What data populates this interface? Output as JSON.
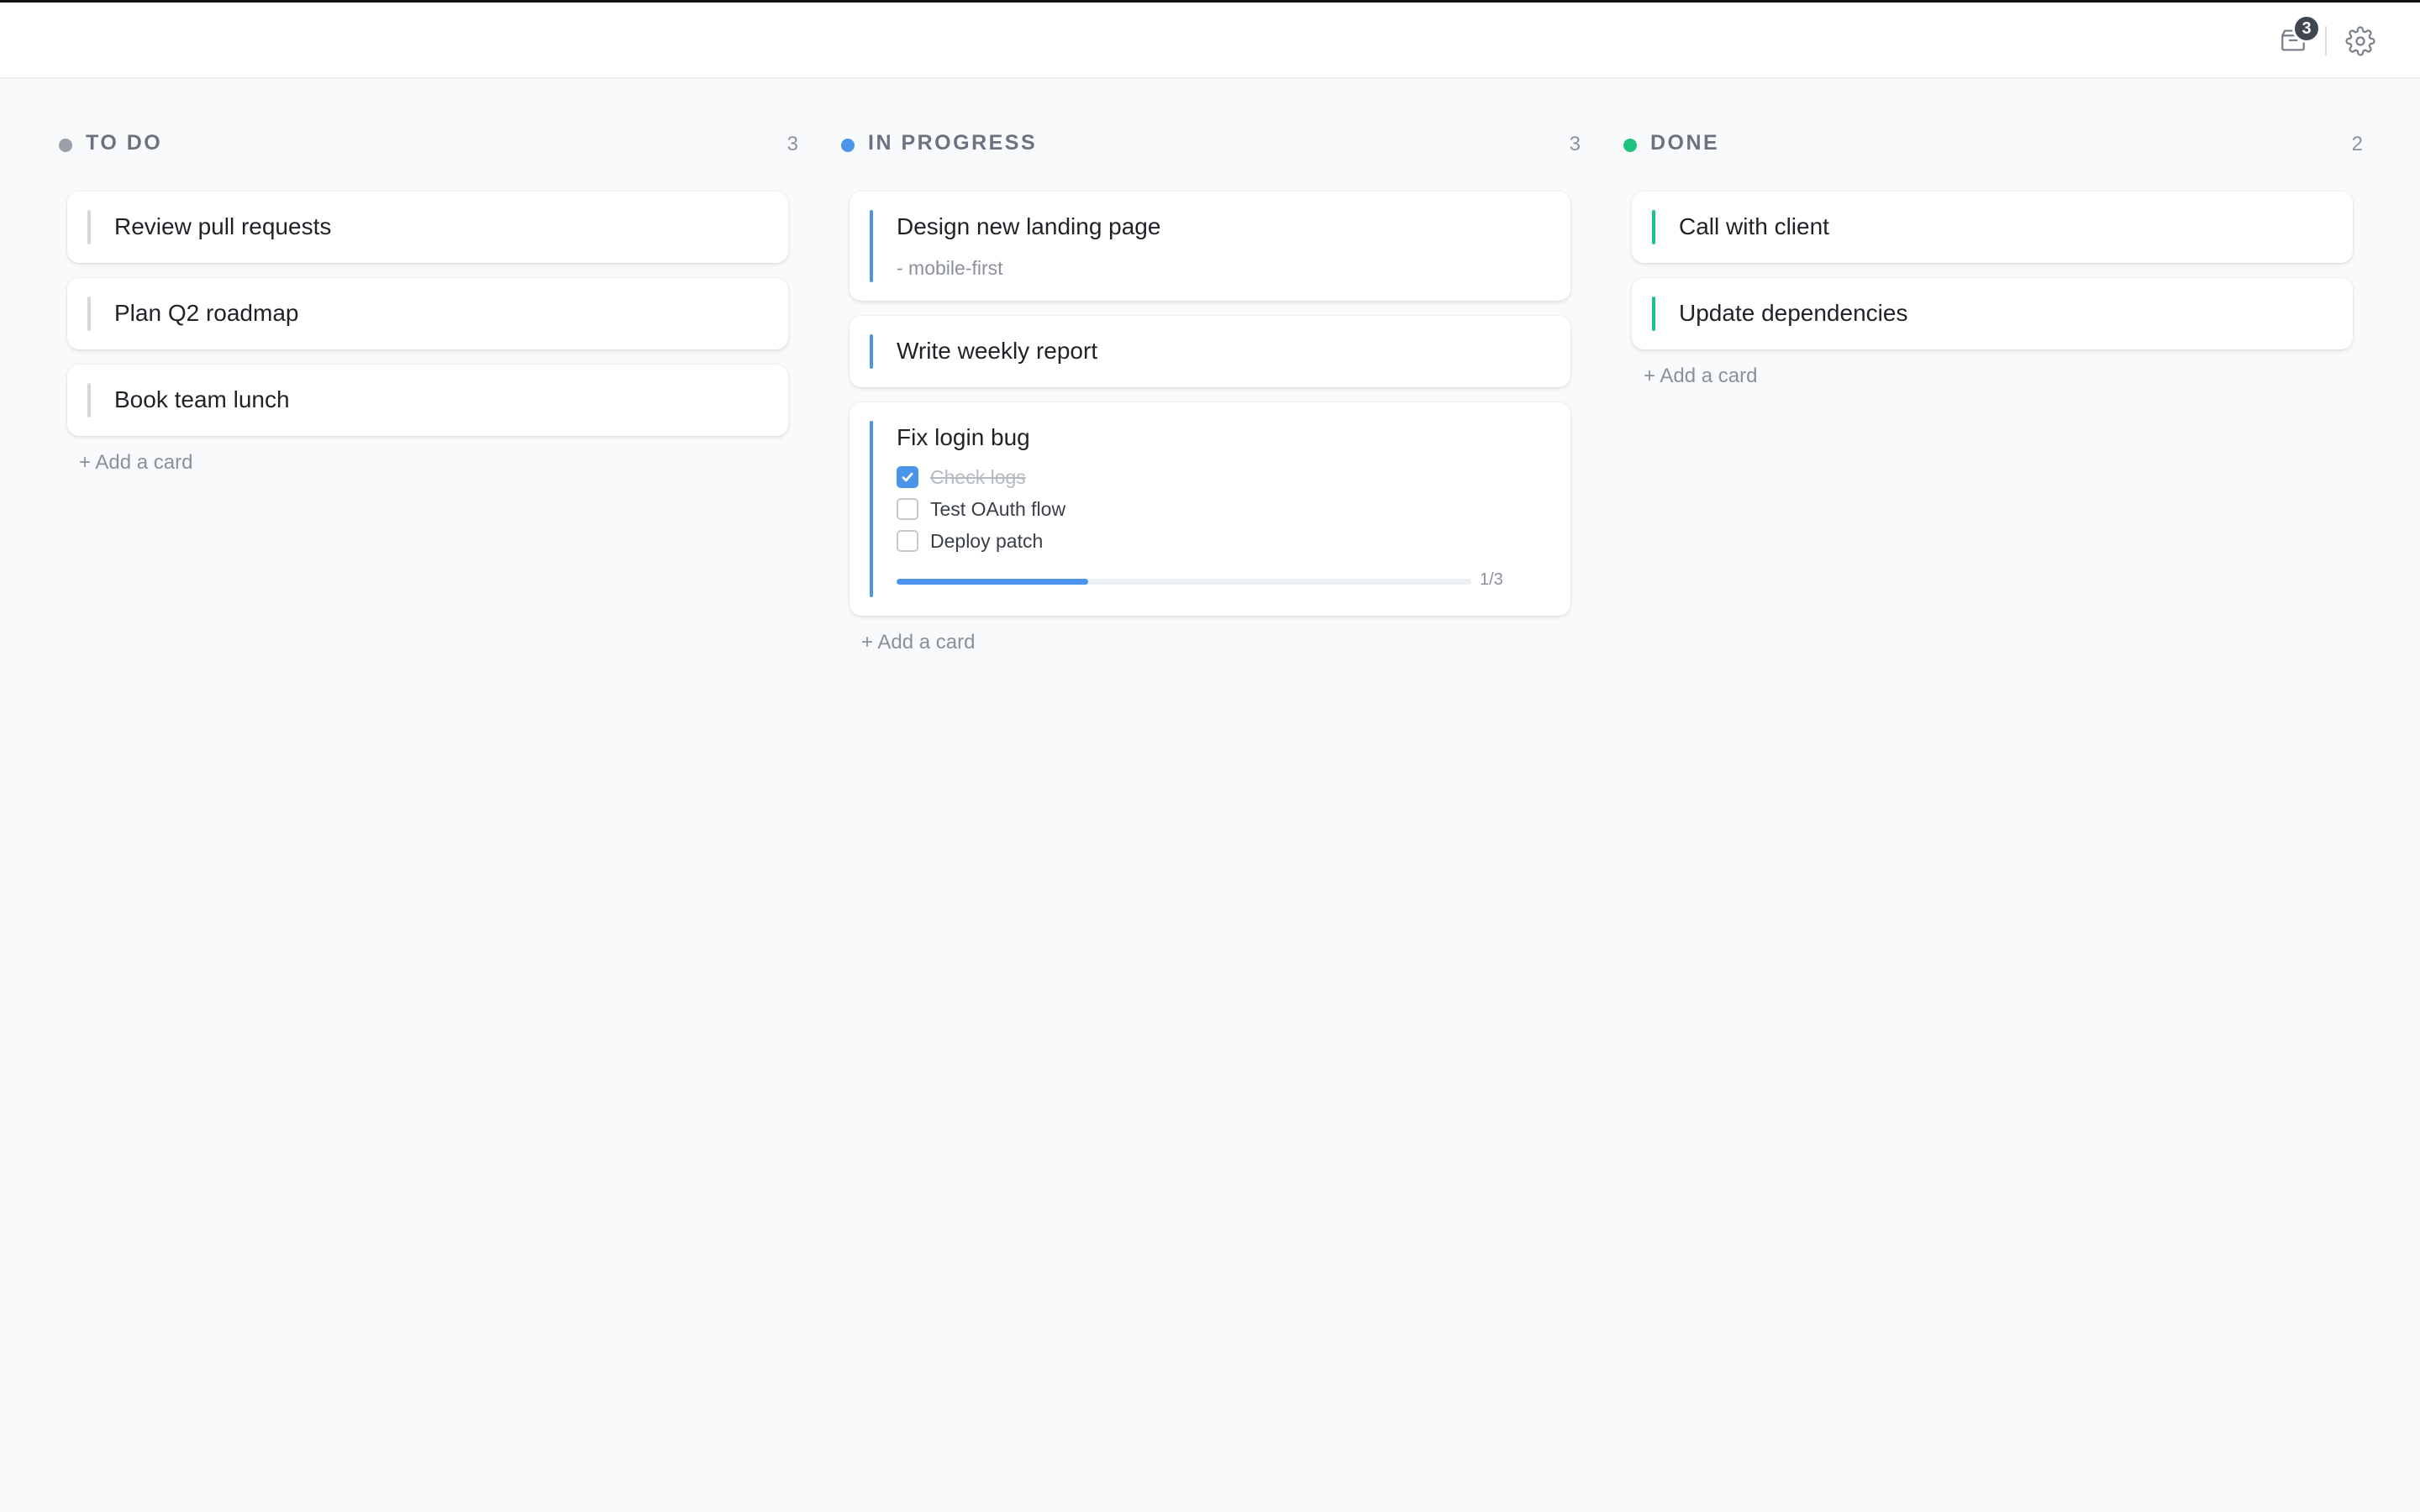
{
  "topbar": {
    "inbox_badge": "3",
    "icons": {
      "inbox": "inbox-icon",
      "settings": "gear-icon"
    }
  },
  "colors": {
    "todo": "#9aa0a8",
    "in_progress": "#4a94ec",
    "done": "#1fc27e",
    "todo_bar": "#d4d7dc"
  },
  "columns": [
    {
      "title": "TO DO",
      "count": "3",
      "cards": [
        {
          "title": "Review pull requests"
        },
        {
          "title": "Plan Q2 roadmap"
        },
        {
          "title": "Book team lunch"
        }
      ],
      "add_label": "+ Add a card"
    },
    {
      "title": "IN PROGRESS",
      "count": "3",
      "cards": [
        {
          "title": "Design new landing page",
          "description": "- mobile-first"
        },
        {
          "title": "Write weekly report"
        },
        {
          "title": "Fix login bug",
          "checklist": [
            {
              "label": "Check logs",
              "checked": true
            },
            {
              "label": "Test OAuth flow",
              "checked": false
            },
            {
              "label": "Deploy patch",
              "checked": false
            }
          ],
          "progress_text": "1/3",
          "progress_fraction": 0.3333
        }
      ],
      "add_label": "+ Add a card"
    },
    {
      "title": "DONE",
      "count": "2",
      "cards": [
        {
          "title": "Call with client"
        },
        {
          "title": "Update dependencies"
        }
      ],
      "add_label": "+ Add a card"
    }
  ]
}
